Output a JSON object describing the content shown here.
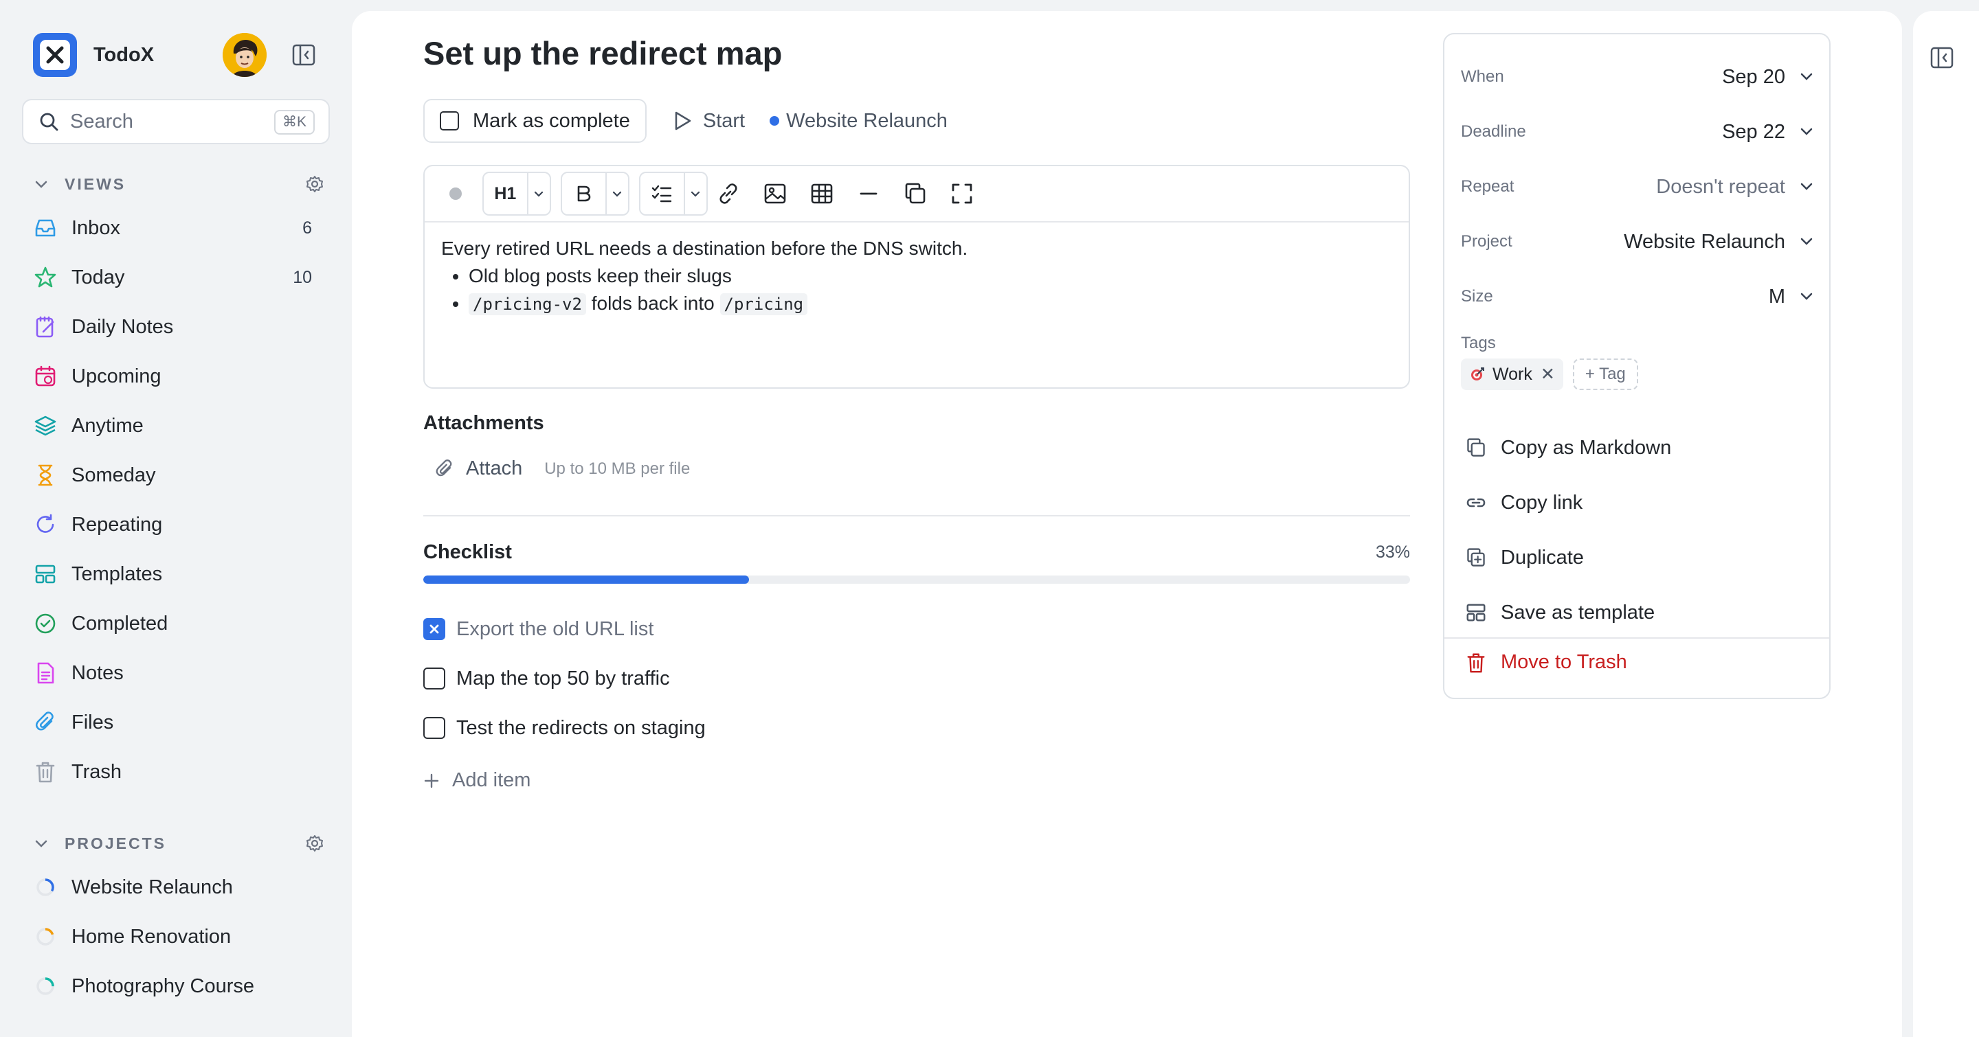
{
  "app": {
    "name": "TodoX"
  },
  "search": {
    "placeholder": "Search",
    "shortcut": "⌘K"
  },
  "views": {
    "heading": "VIEWS",
    "items": [
      {
        "label": "Inbox",
        "count": "6",
        "icon": "inbox-icon",
        "color": "#2f9be6"
      },
      {
        "label": "Today",
        "count": "10",
        "icon": "star-icon",
        "color": "#2bb673"
      },
      {
        "label": "Daily Notes",
        "count": "",
        "icon": "daily-notes-icon",
        "color": "#8b5cf6"
      },
      {
        "label": "Upcoming",
        "count": "",
        "icon": "calendar-icon",
        "color": "#e11d74"
      },
      {
        "label": "Anytime",
        "count": "",
        "icon": "layers-icon",
        "color": "#14a3a8"
      },
      {
        "label": "Someday",
        "count": "",
        "icon": "hourglass-icon",
        "color": "#f29d0c"
      },
      {
        "label": "Repeating",
        "count": "",
        "icon": "repeat-icon",
        "color": "#6366f1"
      },
      {
        "label": "Templates",
        "count": "",
        "icon": "template-icon",
        "color": "#14a3a8"
      },
      {
        "label": "Completed",
        "count": "",
        "icon": "check-circle-icon",
        "color": "#22a05b"
      },
      {
        "label": "Notes",
        "count": "",
        "icon": "note-icon",
        "color": "#d946ef"
      },
      {
        "label": "Files",
        "count": "",
        "icon": "paperclip-icon",
        "color": "#2f9be6"
      },
      {
        "label": "Trash",
        "count": "",
        "icon": "trash-icon",
        "color": "#9ca3af"
      }
    ]
  },
  "projects": {
    "heading": "PROJECTS",
    "items": [
      {
        "label": "Website Relaunch",
        "color": "#2f6fe6",
        "progress": 0.33
      },
      {
        "label": "Home Renovation",
        "color": "#f29d0c",
        "progress": 0.2
      },
      {
        "label": "Photography Course",
        "color": "#14b8a6",
        "progress": 0.25
      }
    ]
  },
  "task": {
    "title": "Set up the redirect map",
    "complete_label": "Mark as complete",
    "start_label": "Start",
    "project_chip": "Website Relaunch",
    "toolbar": {
      "heading_label": "H1",
      "bold_label": "B"
    },
    "body": {
      "intro": "Every retired URL needs a destination before the DNS switch.",
      "bullet1": "Old blog posts keep their slugs",
      "bullet2_code1": "/pricing-v2",
      "bullet2_mid": " folds back into ",
      "bullet2_code2": "/pricing"
    },
    "attachments": {
      "title": "Attachments",
      "attach_label": "Attach",
      "hint": "Up to 10 MB per file"
    },
    "checklist": {
      "title": "Checklist",
      "percent_label": "33%",
      "progress": 0.33,
      "items": [
        {
          "label": "Export the old URL list",
          "done": true
        },
        {
          "label": "Map the top 50 by traffic",
          "done": false
        },
        {
          "label": "Test the redirects on staging",
          "done": false
        }
      ],
      "add_label": "Add item"
    }
  },
  "details": {
    "when": {
      "label": "When",
      "value": "Sep 20"
    },
    "deadline": {
      "label": "Deadline",
      "value": "Sep 22"
    },
    "repeat": {
      "label": "Repeat",
      "value": "Doesn't repeat"
    },
    "project": {
      "label": "Project",
      "value": "Website Relaunch"
    },
    "size": {
      "label": "Size",
      "value": "M"
    },
    "tags": {
      "label": "Tags",
      "items": [
        "Work"
      ],
      "add_label": "+ Tag"
    },
    "menu": {
      "copy_markdown": "Copy as Markdown",
      "copy_link": "Copy link",
      "duplicate": "Duplicate",
      "save_template": "Save as template",
      "move_trash": "Move to Trash"
    }
  },
  "colors": {
    "accent": "#2f6fe6",
    "danger": "#c81e1e"
  }
}
